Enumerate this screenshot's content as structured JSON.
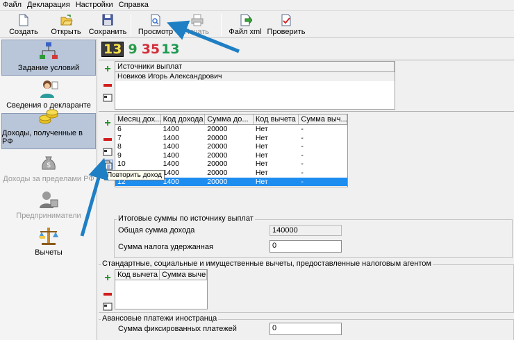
{
  "menu": [
    "Файл",
    "Декларация",
    "Настройки",
    "Справка"
  ],
  "toolbar": {
    "create": "Создать",
    "open": "Открыть",
    "save": "Сохранить",
    "preview": "Просмотр",
    "print": "Печать",
    "xml": "Файл xml",
    "check": "Проверить"
  },
  "sidebar": {
    "items": [
      {
        "label": "Задание условий"
      },
      {
        "label": "Сведения о декларанте"
      },
      {
        "label": "Доходы, полученные в РФ"
      },
      {
        "label": "Доходы за пределами РФ"
      },
      {
        "label": "Предприниматели"
      },
      {
        "label": "Вычеты"
      }
    ]
  },
  "digits": {
    "a": "13",
    "b": "9",
    "c": "35",
    "d": "13"
  },
  "sources": {
    "header": "Источники выплат",
    "rows": [
      "Новиков Игорь Александрович"
    ]
  },
  "income": {
    "headers": [
      "Месяц дох...",
      "Код дохода",
      "Сумма до...",
      "Код вычета",
      "Сумма выч..."
    ],
    "rows": [
      [
        "6",
        "1400",
        "20000",
        "Нет",
        "-"
      ],
      [
        "7",
        "1400",
        "20000",
        "Нет",
        "-"
      ],
      [
        "8",
        "1400",
        "20000",
        "Нет",
        "-"
      ],
      [
        "9",
        "1400",
        "20000",
        "Нет",
        "-"
      ],
      [
        "10",
        "1400",
        "20000",
        "Нет",
        "-"
      ],
      [
        "11",
        "1400",
        "20000",
        "Нет",
        "-"
      ],
      [
        "12",
        "1400",
        "20000",
        "Нет",
        "-"
      ]
    ],
    "selected_row": 6,
    "tooltip": "Повторить доход"
  },
  "totals": {
    "title": "Итоговые суммы по источнику выплат",
    "income_label": "Общая сумма дохода",
    "income_value": "140000",
    "tax_label": "Сумма налога удержанная",
    "tax_value": "0"
  },
  "deductions": {
    "title": "Стандартные, социальные и имущественные вычеты, предоставленные налоговым агентом",
    "headers": [
      "Код вычета",
      "Сумма выче..."
    ]
  },
  "advance": {
    "title": "Авансовые платежи иностранца",
    "label": "Сумма фиксированных платежей",
    "value": "0"
  },
  "colors": {
    "selection": "#1e8df0",
    "arrow": "#1f7fc4",
    "active_nav": "#b9c6d9"
  }
}
